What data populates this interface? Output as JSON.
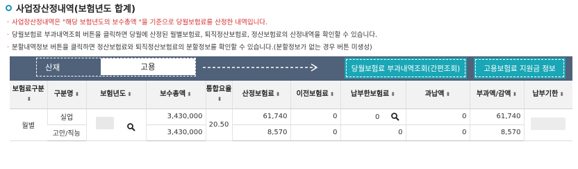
{
  "title": "사업장산정내역(보험년도 합계)",
  "notices": [
    "사업장산정내역은 \"해당 보험년도의 보수총액 \"을 기준으로 당월보험료를 산정한 내역입니다.",
    "당월보험료 부과내역조회 버튼을 클릭하면 당월에 산정된 월별보험료, 퇴직정산보험료, 정산보험료의 산정내역을 확인할 수 있습니다.",
    "분할내역정보 버튼을 클릭하면 정산보험료와 퇴직정산보험료의  분할정보를 확인할 수 있습니다.(분할정보가 없는 경우 버튼 미생성)"
  ],
  "tabs": {
    "sanjae": "산재",
    "goyong": "고용"
  },
  "buttons": {
    "monthly_inquiry": "당월보험료 부과내역조회(간편조회)",
    "support_info": "고용보험료 지원금 정보"
  },
  "table": {
    "headers": {
      "gubun": "보험료구분",
      "gubunmyeong": "구분명",
      "year": "보험년도",
      "bosu": "보수총액",
      "rate": "통합요율",
      "sanjeong": "산정보험료",
      "ijeon": "이전보험료",
      "napbuhan": "납부한보험료",
      "gwanap": "과납액",
      "bugwa": "부과액/감액",
      "napbugihan": "납부기한"
    },
    "sort_glyph": "⬍",
    "group_label": "월별",
    "rate_value": "20.50",
    "rows": [
      {
        "name": "실업",
        "bosu": "3,430,000",
        "sanjeong": "61,740",
        "ijeon": "0",
        "napbuhan": "0",
        "gwanap": "0",
        "bugwa": "61,740"
      },
      {
        "name": "고안/직능",
        "bosu": "3,430,000",
        "sanjeong": "8,570",
        "ijeon": "0",
        "napbuhan": "0",
        "gwanap": "0",
        "bugwa": "8,570"
      }
    ]
  },
  "colors": {
    "toolbar": "#50617a",
    "teal_button": "#1aa6b5",
    "notice_red": "#d42b2b",
    "title_dot": "#1c8fb0"
  }
}
